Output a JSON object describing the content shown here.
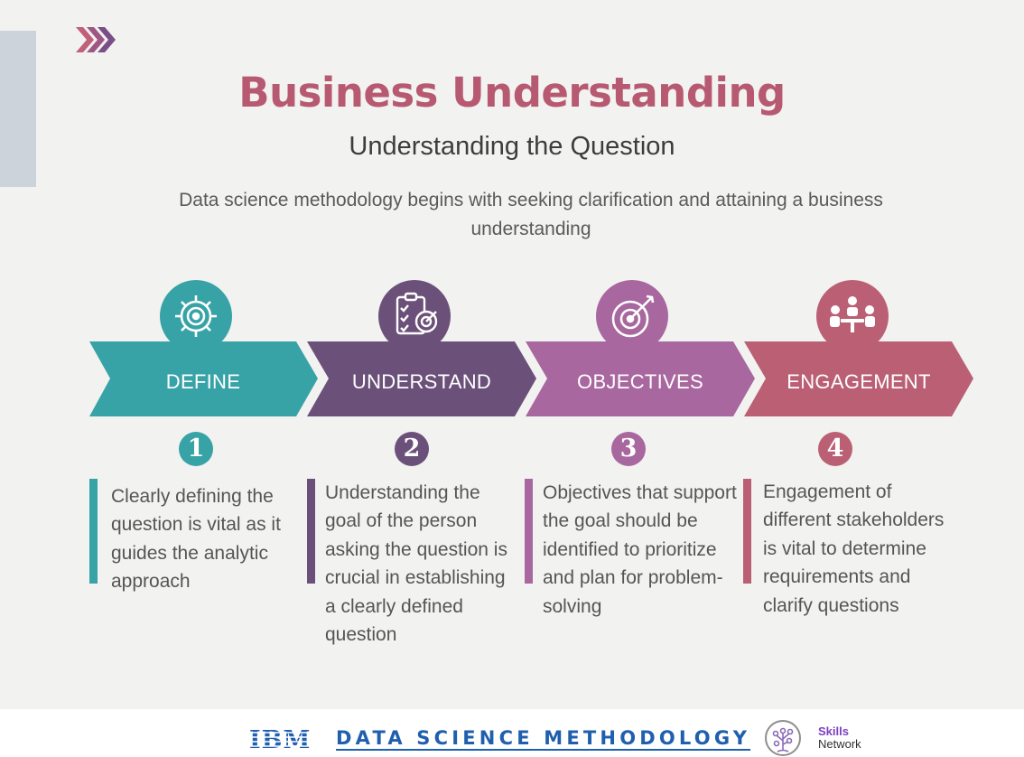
{
  "header": {
    "title": "Business Understanding",
    "subtitle": "Understanding the Question",
    "intro": "Data science methodology begins with seeking clarification and attaining a business understanding"
  },
  "steps": [
    {
      "label": "DEFINE",
      "number": "1",
      "color": "#38a3a6",
      "icon": "gear-target-icon",
      "description": "Clearly defining the question is vital as it guides the analytic approach"
    },
    {
      "label": "UNDERSTAND",
      "number": "2",
      "color": "#6b5179",
      "icon": "clipboard-target-icon",
      "description": "Understanding the goal of the person asking the question is crucial in establishing a clearly defined question"
    },
    {
      "label": "OBJECTIVES",
      "number": "3",
      "color": "#a8679e",
      "icon": "target-arrow-icon",
      "description": "Objectives that support the goal should be identified to prioritize and plan for problem-solving"
    },
    {
      "label": "ENGAGEMENT",
      "number": "4",
      "color": "#bb6074",
      "icon": "meeting-people-icon",
      "description": "Engagement of different stakeholders is vital to determine requirements and clarify questions"
    }
  ],
  "footer": {
    "brand": "IBM",
    "title": "DATA SCIENCE METHODOLOGY",
    "skills_line1": "Skills",
    "skills_line2": "Network"
  },
  "colors": {
    "title": "#b75a71",
    "footer_link": "#1f5fae",
    "side_bar": "#cdd3da"
  }
}
